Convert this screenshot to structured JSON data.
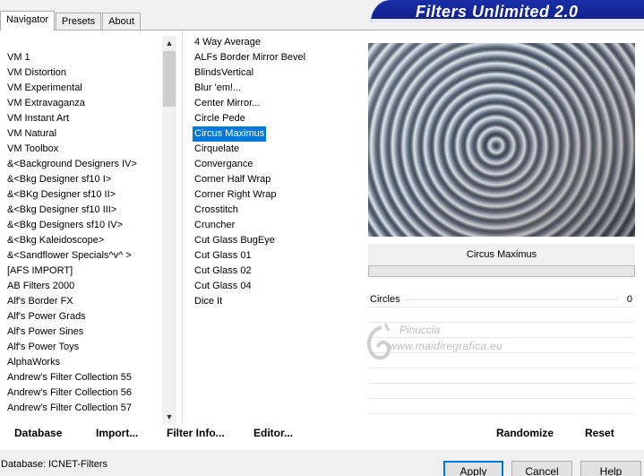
{
  "window": {
    "title": "Filters Unlimited 2.0"
  },
  "tabs": [
    {
      "label": "Navigator"
    },
    {
      "label": "Presets"
    },
    {
      "label": "About"
    }
  ],
  "categories": [
    "VM 1",
    "VM Distortion",
    "VM Experimental",
    "VM Extravaganza",
    "VM Instant Art",
    "VM Natural",
    "VM Toolbox",
    "&<Background Designers IV>",
    "&<Bkg Designer sf10 I>",
    "&<BKg Designer sf10 II>",
    "&<Bkg Designer sf10 III>",
    "&<Bkg Designers sf10 IV>",
    "&<Bkg Kaleidoscope>",
    "&<Sandflower Specials^v^ >",
    "[AFS IMPORT]",
    "AB Filters 2000",
    "Alf's Border FX",
    "Alf's Power Grads",
    "Alf's Power Sines",
    "Alf's Power Toys",
    "AlphaWorks",
    "Andrew's Filter Collection 55",
    "Andrew's Filter Collection 56",
    "Andrew's Filter Collection 57"
  ],
  "filters": [
    "4 Way Average",
    "ALFs Border Mirror Bevel",
    "BlindsVertical",
    "Blur 'em!...",
    "Center Mirror...",
    "Circle Pede",
    "Circus Maximus",
    "Cirquelate",
    "Convergance",
    "Corner Half Wrap",
    "Corner Right Wrap",
    "Crosstitch",
    "Cruncher",
    "Cut Glass  BugEye",
    "Cut Glass 01",
    "Cut Glass 02",
    "Cut Glass 04",
    "Dice It"
  ],
  "selected_filter": "Circus Maximus",
  "preview": {
    "filter_name": "Circus Maximus",
    "progress": 0
  },
  "params": [
    {
      "label": "Circles",
      "value": "0"
    }
  ],
  "watermark": {
    "line1": "Pinuccia",
    "line2": "www.maidiregrafica.eu"
  },
  "buttons": {
    "database": "Database",
    "import": "Import...",
    "filter_info": "Filter Info...",
    "editor": "Editor...",
    "randomize": "Randomize",
    "reset": "Reset",
    "apply": "Apply",
    "cancel": "Cancel",
    "help": "Help"
  },
  "status": {
    "database_label": "Database:",
    "database_value": "ICNET-Filters"
  },
  "icons": {
    "scroll_up": "chevron-up-icon",
    "scroll_down": "chevron-down-icon",
    "watermark": "swirl-logo-icon"
  }
}
